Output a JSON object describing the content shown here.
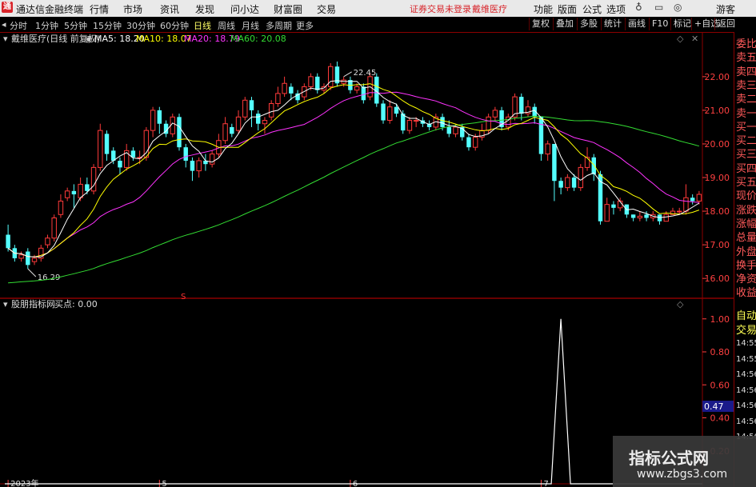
{
  "app": {
    "title": "通达信金融终端"
  },
  "menu": [
    "行情",
    "市场",
    "资讯",
    "发现",
    "问小达",
    "财富圈",
    "交易"
  ],
  "notice": {
    "trade": "证券交易未登录",
    "stock": "戴维医疗"
  },
  "menu_right": [
    "功能",
    "版面",
    "公式",
    "选项"
  ],
  "guest": "游客",
  "periods": [
    "分时",
    "1分钟",
    "5分钟",
    "15分钟",
    "30分钟",
    "60分钟",
    "日线",
    "周线",
    "月线",
    "多周期",
    "更多"
  ],
  "active_period": "日线",
  "right_tools": [
    "复权",
    "叠加",
    "多股",
    "统计",
    "画线",
    "F10",
    "标记",
    "+自选",
    "返回"
  ],
  "main_header": {
    "stock_label": "戴维医疗(日线 前复权)",
    "ma5": "MA5: 18.20",
    "ma10": "MA10: 18.07",
    "ma20": "MA20: 18.79",
    "ma60": "MA60: 20.08"
  },
  "sub_header": {
    "indicator": "股朋指标网",
    "value_label": "买点: 0.00"
  },
  "side_labels": [
    "委比",
    "卖五",
    "卖四",
    "卖三",
    "卖二",
    "卖一",
    "买一",
    "买二",
    "买三",
    "买四",
    "买五",
    "现价",
    "涨跌",
    "涨幅",
    "总量",
    "外盘",
    "换手",
    "净资",
    "收益"
  ],
  "side_lower": {
    "auto": "自动",
    "trade": "交易",
    "times": [
      "14:55",
      "14:55",
      "14:56",
      "14:56",
      "14:56",
      "14:56",
      "14:56"
    ]
  },
  "watermark": {
    "line1": "指标公式网",
    "line2": "www.zbgs3.com"
  },
  "colors": {
    "up": "#ff3a3a",
    "down": "#54ffff",
    "ma5": "#ffffff",
    "ma10": "#ffff00",
    "ma20": "#ff33ff",
    "ma60": "#33dd33",
    "axis": "#ff4040"
  },
  "chart_data": [
    {
      "type": "candlestick",
      "title": "戴维医疗(日线 前复权)",
      "ylim": [
        15.6,
        22.9
      ],
      "y_ticks": [
        16.0,
        17.0,
        18.0,
        19.0,
        20.0,
        21.0,
        22.0
      ],
      "x_labels": [
        {
          "index": 0,
          "label": "2023年"
        },
        {
          "index": 23,
          "label": "5"
        },
        {
          "index": 52,
          "label": "6"
        },
        {
          "index": 81,
          "label": "7"
        }
      ],
      "annotations": [
        {
          "label": "22.45",
          "index": 51
        },
        {
          "label": "16.29",
          "index": 3
        }
      ],
      "candles": [
        [
          17.3,
          16.9,
          17.6,
          16.8
        ],
        [
          16.9,
          16.6,
          17.0,
          16.5
        ],
        [
          16.6,
          16.7,
          16.8,
          16.5
        ],
        [
          16.8,
          16.4,
          16.9,
          16.29
        ],
        [
          16.5,
          16.6,
          16.7,
          16.4
        ],
        [
          16.6,
          16.9,
          17.0,
          16.5
        ],
        [
          17.0,
          17.2,
          17.3,
          16.9
        ],
        [
          17.2,
          17.8,
          17.9,
          17.1
        ],
        [
          17.9,
          18.3,
          18.5,
          17.8
        ],
        [
          18.4,
          18.6,
          18.7,
          18.3
        ],
        [
          18.6,
          18.5,
          18.8,
          18.1
        ],
        [
          18.4,
          18.8,
          19.0,
          18.3
        ],
        [
          18.8,
          18.6,
          19.0,
          18.5
        ],
        [
          18.6,
          19.3,
          19.4,
          18.5
        ],
        [
          19.3,
          20.4,
          20.6,
          19.2
        ],
        [
          20.3,
          19.7,
          20.4,
          19.5
        ],
        [
          19.8,
          19.5,
          19.9,
          19.4
        ],
        [
          19.5,
          19.3,
          19.6,
          19.1
        ],
        [
          19.3,
          19.8,
          20.0,
          19.2
        ],
        [
          19.8,
          19.6,
          19.9,
          19.5
        ],
        [
          19.6,
          19.6,
          19.8,
          19.4
        ],
        [
          19.6,
          20.4,
          20.5,
          19.5
        ],
        [
          20.4,
          21.0,
          21.1,
          20.2
        ],
        [
          21.0,
          20.6,
          21.1,
          20.3
        ],
        [
          20.6,
          20.3,
          20.7,
          20.2
        ],
        [
          20.3,
          20.8,
          20.9,
          20.2
        ],
        [
          20.8,
          19.9,
          20.9,
          19.8
        ],
        [
          19.9,
          19.5,
          20.0,
          19.3
        ],
        [
          19.5,
          19.2,
          19.6,
          18.9
        ],
        [
          19.2,
          19.5,
          19.6,
          19.0
        ],
        [
          19.5,
          19.4,
          19.7,
          19.2
        ],
        [
          19.4,
          19.7,
          19.8,
          19.3
        ],
        [
          19.7,
          20.1,
          20.3,
          19.6
        ],
        [
          20.1,
          20.6,
          20.8,
          20.0
        ],
        [
          20.5,
          20.3,
          20.6,
          20.2
        ],
        [
          20.4,
          20.8,
          21.0,
          20.3
        ],
        [
          20.8,
          21.3,
          21.4,
          20.7
        ],
        [
          21.3,
          21.0,
          21.4,
          20.5
        ],
        [
          20.9,
          20.6,
          21.0,
          20.4
        ],
        [
          20.6,
          20.7,
          20.8,
          20.3
        ],
        [
          20.8,
          21.2,
          21.3,
          20.7
        ],
        [
          21.2,
          21.5,
          21.7,
          21.1
        ],
        [
          21.5,
          21.8,
          22.0,
          21.4
        ],
        [
          21.7,
          21.5,
          21.8,
          21.3
        ],
        [
          21.5,
          21.3,
          21.6,
          21.2
        ],
        [
          21.4,
          21.7,
          21.8,
          21.3
        ],
        [
          21.7,
          22.0,
          22.1,
          21.6
        ],
        [
          22.0,
          21.6,
          22.1,
          21.5
        ],
        [
          21.6,
          21.7,
          21.8,
          21.5
        ],
        [
          21.7,
          22.3,
          22.4,
          21.6
        ],
        [
          22.3,
          21.8,
          22.45,
          21.7
        ],
        [
          21.8,
          21.9,
          22.0,
          21.7
        ],
        [
          21.9,
          21.6,
          22.0,
          21.5
        ],
        [
          21.6,
          21.7,
          21.8,
          21.5
        ],
        [
          21.7,
          21.3,
          21.8,
          21.2
        ],
        [
          21.4,
          22.0,
          22.1,
          21.3
        ],
        [
          22.0,
          21.2,
          22.1,
          21.1
        ],
        [
          21.2,
          20.7,
          21.3,
          20.6
        ],
        [
          20.7,
          21.1,
          21.3,
          20.6
        ],
        [
          21.1,
          20.9,
          21.2,
          20.8
        ],
        [
          20.9,
          20.4,
          21.0,
          20.3
        ],
        [
          20.4,
          20.7,
          20.8,
          20.3
        ],
        [
          20.7,
          20.7,
          20.8,
          20.5
        ],
        [
          20.7,
          20.6,
          20.8,
          20.5
        ],
        [
          20.6,
          20.5,
          20.7,
          20.4
        ],
        [
          20.5,
          20.8,
          20.9,
          20.4
        ],
        [
          20.8,
          20.5,
          20.9,
          20.4
        ],
        [
          20.5,
          20.3,
          20.7,
          20.2
        ],
        [
          20.3,
          20.5,
          20.6,
          20.2
        ],
        [
          20.5,
          20.2,
          20.6,
          20.1
        ],
        [
          20.2,
          19.9,
          20.3,
          19.8
        ],
        [
          19.9,
          20.2,
          20.3,
          19.8
        ],
        [
          20.2,
          20.4,
          20.6,
          20.1
        ],
        [
          20.4,
          20.8,
          20.9,
          20.3
        ],
        [
          20.8,
          21.0,
          21.1,
          20.7
        ],
        [
          21.0,
          20.5,
          21.1,
          20.4
        ],
        [
          20.5,
          20.8,
          20.9,
          20.4
        ],
        [
          20.8,
          21.4,
          21.5,
          20.7
        ],
        [
          21.4,
          20.9,
          21.5,
          20.7
        ],
        [
          20.9,
          21.1,
          21.3,
          20.8
        ],
        [
          21.1,
          20.8,
          21.2,
          20.6
        ],
        [
          20.8,
          19.7,
          20.8,
          19.5
        ],
        [
          19.7,
          20.0,
          20.1,
          19.5
        ],
        [
          20.0,
          18.9,
          20.0,
          18.3
        ],
        [
          18.9,
          18.7,
          19.0,
          18.5
        ],
        [
          18.7,
          19.0,
          19.1,
          18.6
        ],
        [
          19.0,
          18.7,
          19.1,
          18.6
        ],
        [
          18.7,
          19.3,
          19.4,
          18.6
        ],
        [
          19.3,
          19.6,
          19.9,
          19.2
        ],
        [
          19.6,
          19.1,
          19.7,
          18.9
        ],
        [
          19.1,
          17.7,
          19.2,
          17.6
        ],
        [
          17.7,
          18.2,
          18.4,
          17.7
        ],
        [
          18.2,
          18.1,
          18.3,
          17.9
        ],
        [
          18.1,
          18.3,
          18.4,
          18.0
        ],
        [
          18.2,
          17.9,
          18.2,
          17.8
        ],
        [
          17.9,
          17.8,
          17.9,
          17.7
        ],
        [
          17.8,
          17.85,
          18.0,
          17.7
        ],
        [
          17.9,
          17.8,
          18.0,
          17.7
        ],
        [
          17.8,
          17.9,
          18.0,
          17.7
        ],
        [
          17.9,
          17.7,
          17.9,
          17.6
        ],
        [
          17.7,
          17.9,
          18.0,
          17.7
        ],
        [
          17.9,
          18.0,
          18.1,
          17.9
        ],
        [
          18.0,
          18.0,
          18.1,
          17.9
        ],
        [
          18.0,
          18.4,
          18.8,
          17.9
        ],
        [
          18.4,
          18.3,
          18.5,
          18.2
        ],
        [
          18.3,
          18.5,
          18.6,
          18.2
        ]
      ]
    },
    {
      "type": "line",
      "title": "股朋指标网",
      "ylim": [
        0,
        1.12
      ],
      "y_ticks": [
        0.0,
        0.2,
        0.4,
        0.6,
        0.8,
        1.0
      ],
      "current_marker": "0.47",
      "spike_index": 84,
      "series": [
        {
          "name": "买点",
          "peak": 1.0
        }
      ]
    }
  ]
}
